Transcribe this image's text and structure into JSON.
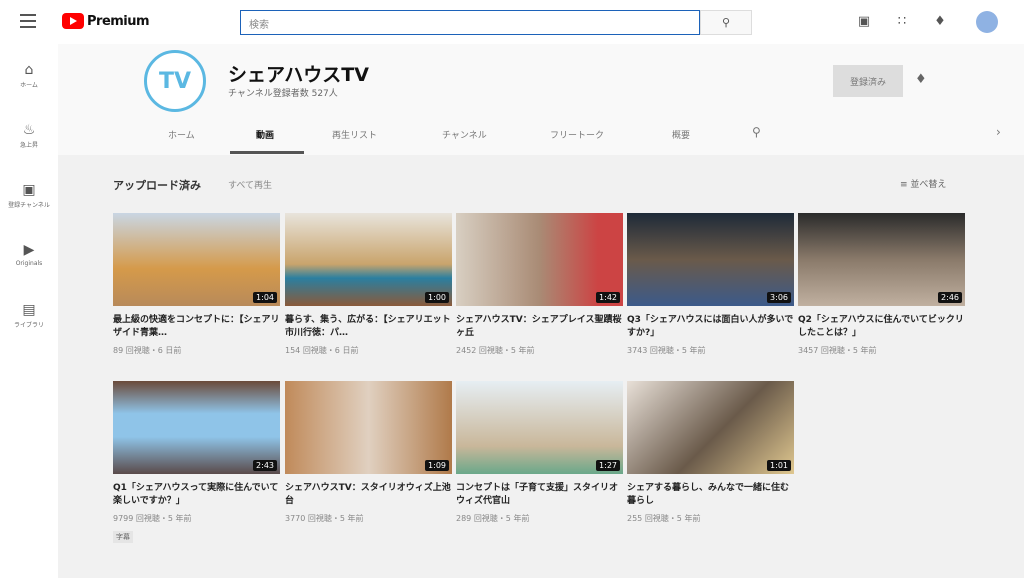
{
  "topbar": {
    "logo": "Premium",
    "search_placeholder": "検索",
    "search_icon": "search-icon"
  },
  "sidebar": [
    {
      "label": "ホーム",
      "icon": "⌂"
    },
    {
      "label": "急上昇",
      "icon": "♨"
    },
    {
      "label": "登録チャンネル",
      "icon": "▣"
    },
    {
      "label": "Originals",
      "icon": "▶"
    },
    {
      "label": "ライブラリ",
      "icon": "▤"
    }
  ],
  "channel": {
    "name": "シェアハウスTV",
    "subscribers": "チャンネル登録者数 527人",
    "subscribe_label": "登録済み",
    "logo": "SHARE HOUSE TV"
  },
  "tabs": [
    "ホーム",
    "動画",
    "再生リスト",
    "チャンネル",
    "フリートーク",
    "概要"
  ],
  "section": {
    "title": "アップロード済み",
    "play_all": "すべて再生",
    "sort": "並べ替え"
  },
  "videos": [
    {
      "title": "最上級の快適をコンセプトに：【シェアリザイド青葉…",
      "meta": "89 回視聴・6 日前",
      "duration": "1:04",
      "bg": "linear-gradient(#c9d6e3,#d59a4a 60%,#b88a5a)"
    },
    {
      "title": "暮らす、集う、広がる：【シェアリエット市川行徳：パ…",
      "meta": "154 回視聴・6 日前",
      "duration": "1:00",
      "bg": "linear-gradient(#e8e4dc,#c9a46c 55%,#2b7fa0 70%,#8a5a3a)"
    },
    {
      "title": "シェアハウスTV：シェアプレイス聖蹟桜ヶ丘",
      "meta": "2452 回視聴・5 年前",
      "duration": "1:42",
      "bg": "linear-gradient(90deg,#d8cfc2,#a98b75 50%,#c44 85%)"
    },
    {
      "title": "Q3「シェアハウスには面白い人が多いですか?」",
      "meta": "3743 回視聴・5 年前",
      "duration": "3:06",
      "bg": "linear-gradient(#1e2a38,#6a5a4a 50%,#3c5a8a)"
    },
    {
      "title": "Q2「シェアハウスに住んでいてビックリしたことは？」",
      "meta": "3457 回視聴・5 年前",
      "duration": "2:46",
      "bg": "linear-gradient(#2b2b2b,#8a7a6a 50%,#c0b0a0)"
    },
    {
      "title": "Q1「シェアハウスって実際に住んでいて楽しいですか？」",
      "meta": "9799 回視聴・5 年前",
      "duration": "2:43",
      "badge": "字幕",
      "bg": "linear-gradient(#6a4a3a,#8fc4e8 35%,#8fc4e8 60%,#5a4a4a)"
    },
    {
      "title": "シェアハウスTV：スタイリオウィズ上池台",
      "meta": "3770 回視聴・5 年前",
      "duration": "1:09",
      "bg": "linear-gradient(90deg,#c08a5a,#e0d0c0 50%,#b07a4a)"
    },
    {
      "title": "コンセプトは「子育て支援」スタイリオウィズ代官山",
      "meta": "289 回視聴・5 年前",
      "duration": "1:27",
      "bg": "linear-gradient(#e6eef3,#c9b79a 70%,#6aa88a)"
    },
    {
      "title": "シェアする暮らし、みんなで一緒に住む暮らし",
      "meta": "255 回視聴・5 年前",
      "duration": "1:01",
      "bg": "linear-gradient(135deg,#e8e0d8,#6a5a4a 55%,#e0c890)"
    }
  ]
}
